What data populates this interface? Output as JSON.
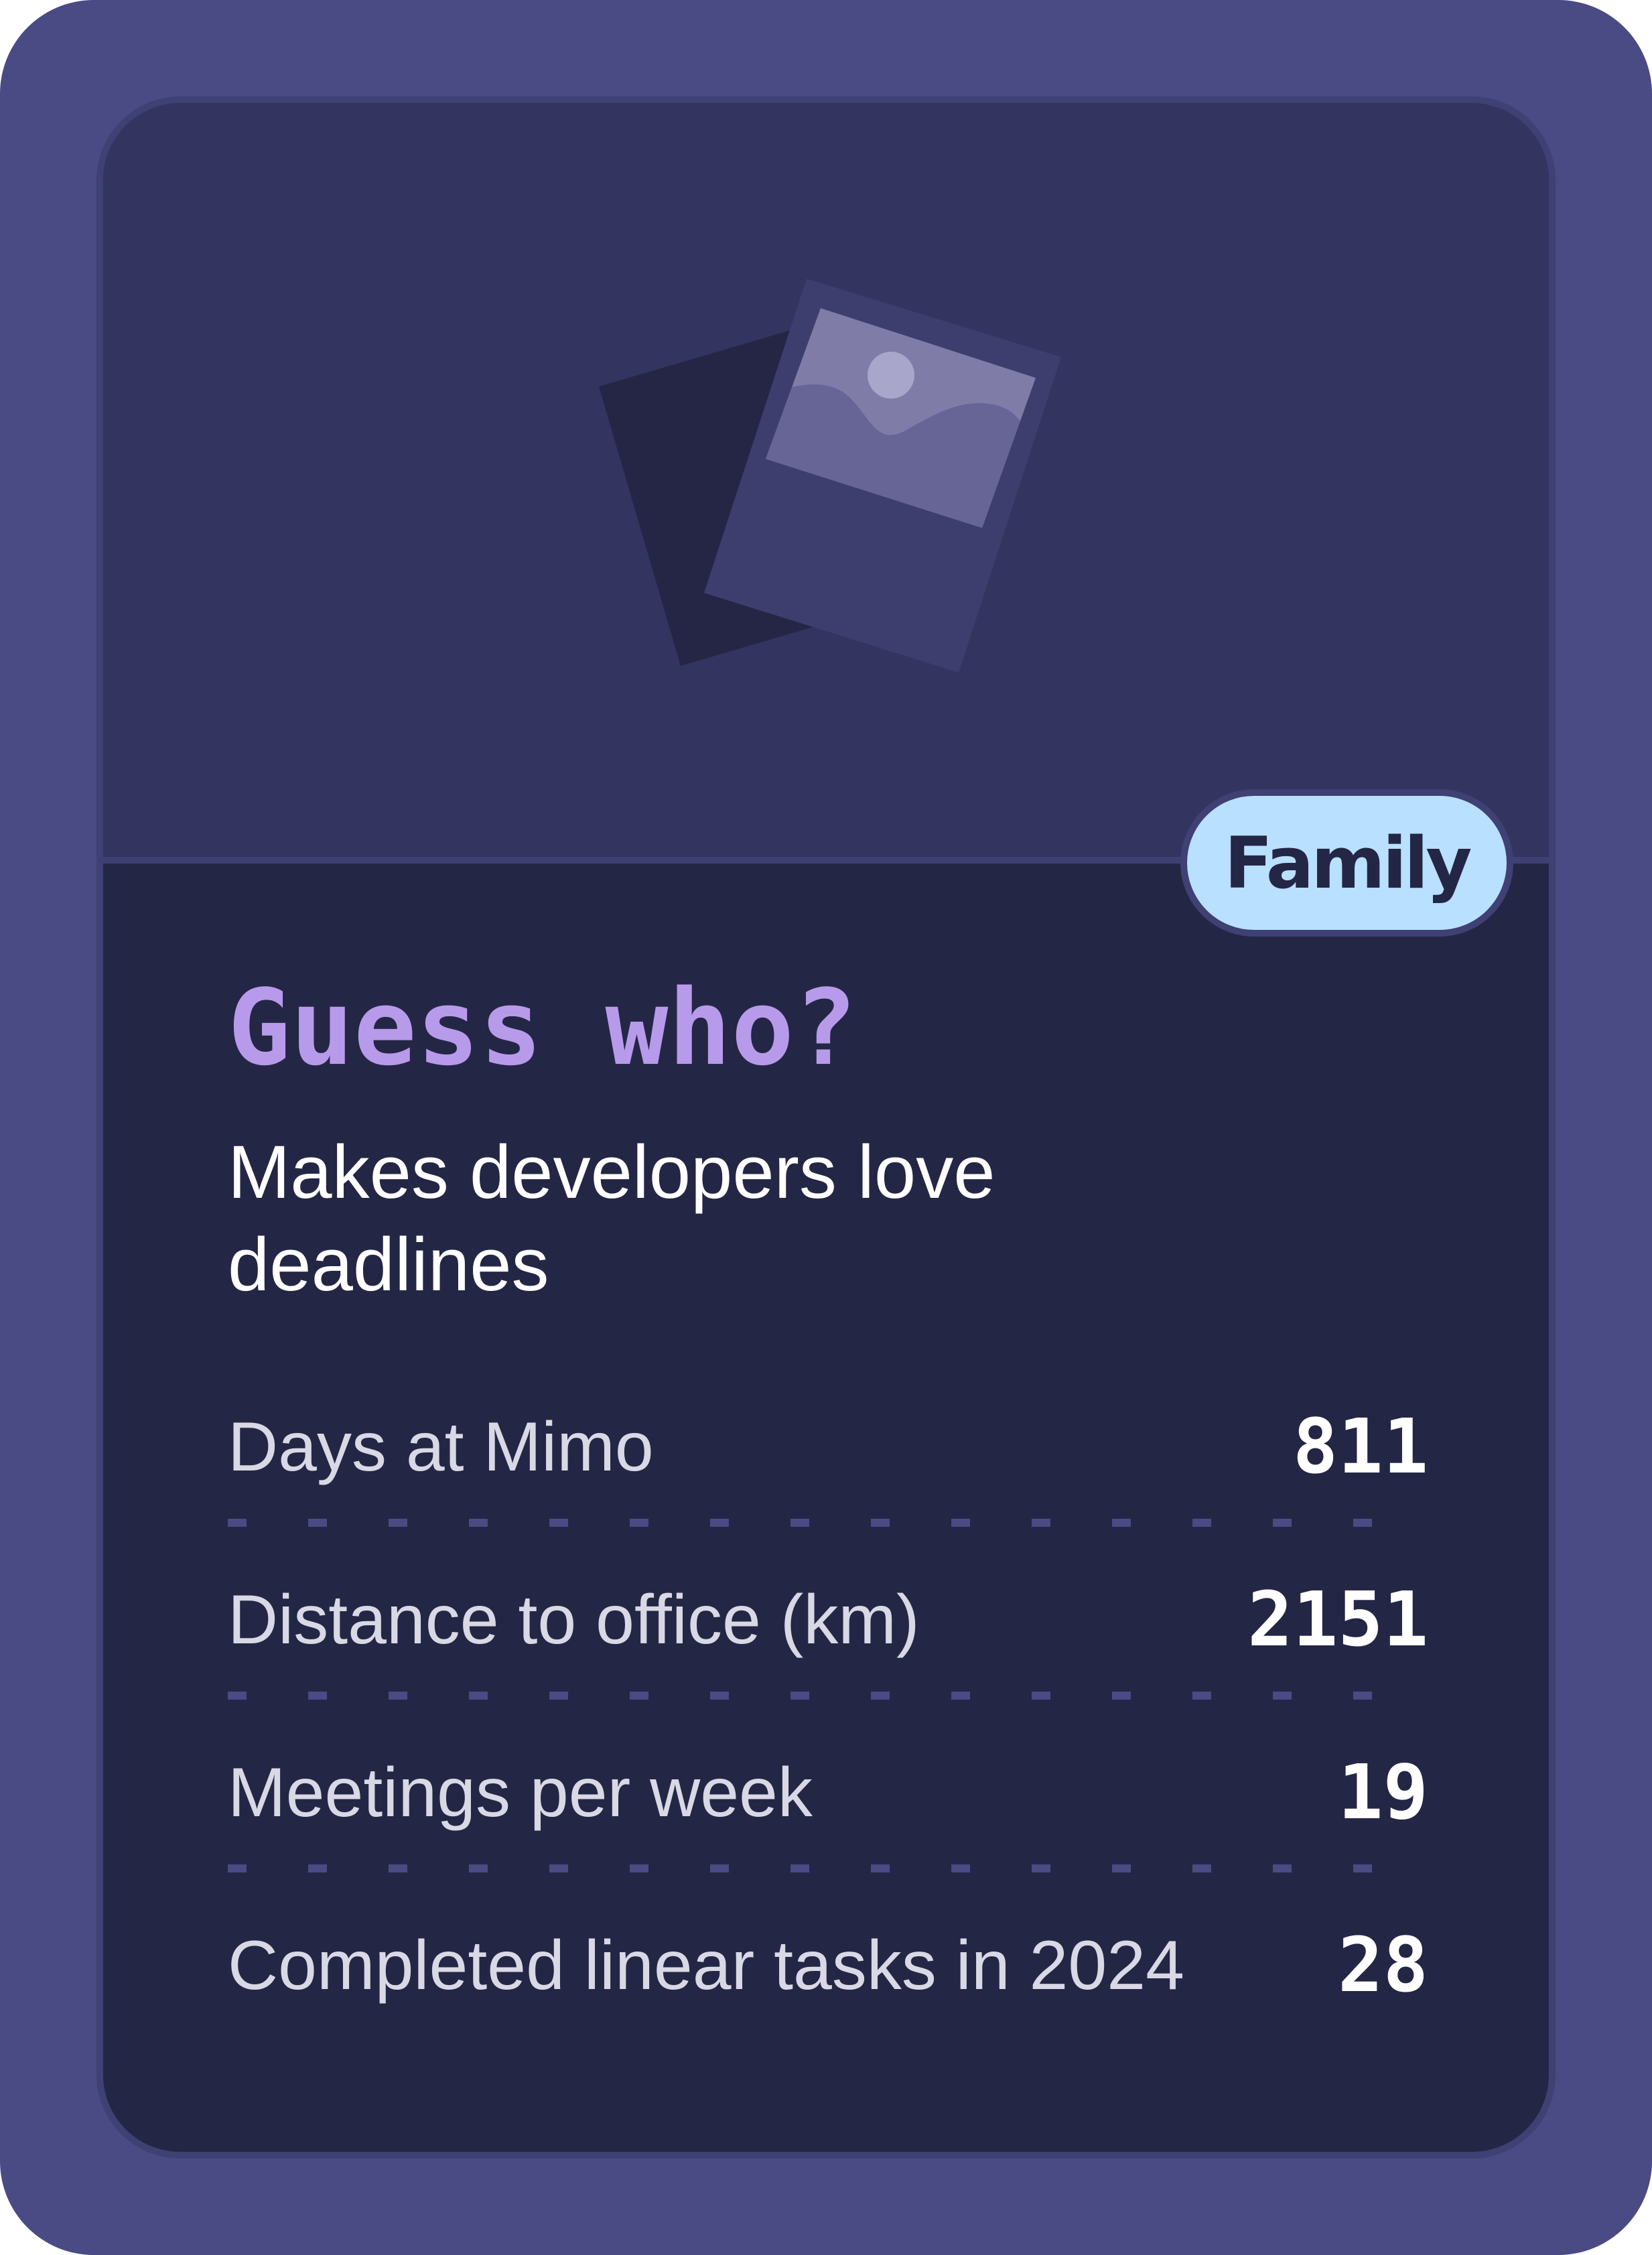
{
  "card": {
    "image_icon": "photo-cards-icon",
    "tag": "Family",
    "title": "Guess who?",
    "subtitle": "Makes developers love deadlines",
    "stats": [
      {
        "label": "Days at Mimo",
        "value": "811"
      },
      {
        "label": "Distance to office (km)",
        "value": "2151"
      },
      {
        "label": "Meetings per week",
        "value": "19"
      },
      {
        "label": "Completed linear tasks in 2024",
        "value": "28"
      }
    ]
  },
  "colors": {
    "frame": "#4a4b84",
    "hero_bg": "#343460",
    "body_bg": "#242645",
    "title": "#b89aeb",
    "tag_bg": "#b9e0fe"
  }
}
